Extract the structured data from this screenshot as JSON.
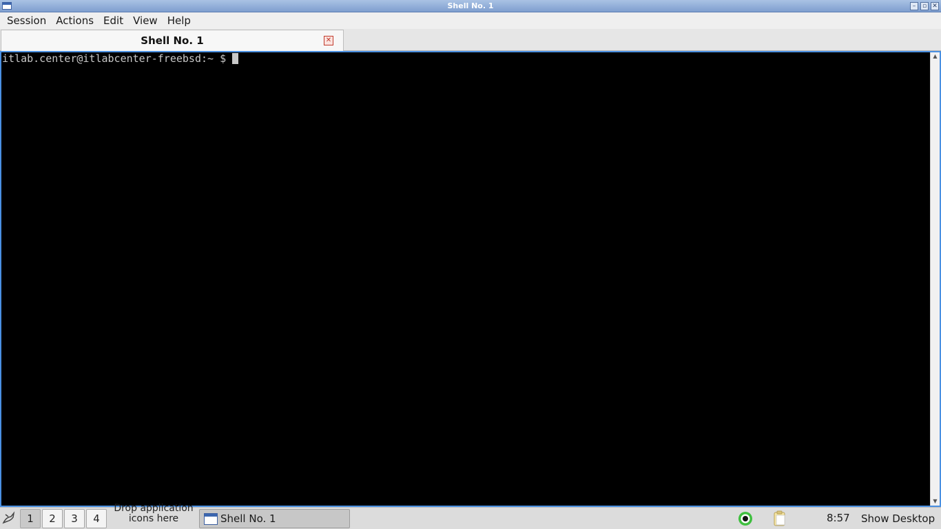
{
  "window": {
    "title": "Shell No. 1",
    "minimize_glyph": "–",
    "maximize_glyph": "▫",
    "close_glyph": "✕"
  },
  "menu": {
    "items": [
      "Session",
      "Actions",
      "Edit",
      "View",
      "Help"
    ]
  },
  "tabs": [
    {
      "label": "Shell No. 1",
      "close_glyph": "✕",
      "active": true
    }
  ],
  "terminal": {
    "prompt": "itlab.center@itlabcenter-freebsd:~ $ ",
    "background": "#000000",
    "foreground": "#c8c8c8",
    "scroll_up_glyph": "▲",
    "scroll_down_glyph": "▼"
  },
  "taskbar": {
    "desktops": [
      "1",
      "2",
      "3",
      "4"
    ],
    "active_desktop": "1",
    "drop_text": "Drop application icons here",
    "task_label": "Shell No. 1",
    "clock": "8:57",
    "show_desktop": "Show Desktop"
  },
  "colors": {
    "accent": "#4a90e2",
    "titlebar": "#8aa8d6",
    "close_red": "#c0392b"
  }
}
